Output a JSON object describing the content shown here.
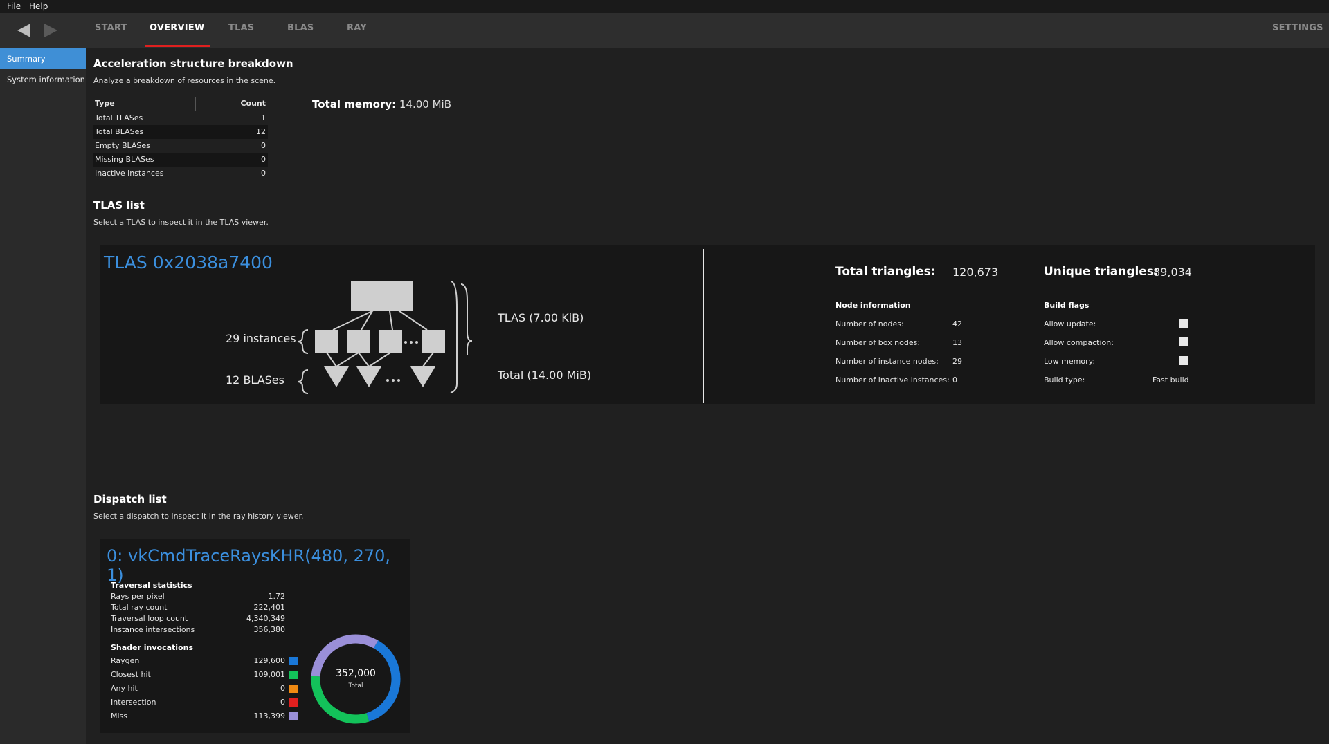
{
  "menu": {
    "file": "File",
    "help": "Help"
  },
  "nav": {
    "tabs": [
      "START",
      "OVERVIEW",
      "TLAS",
      "BLAS",
      "RAY"
    ],
    "settings": "SETTINGS"
  },
  "sidebar": {
    "items": [
      "Summary",
      "System information"
    ]
  },
  "breakdown": {
    "title": "Acceleration structure breakdown",
    "subtitle": "Analyze a breakdown of resources in the scene.",
    "col_type": "Type",
    "col_count": "Count",
    "rows": [
      {
        "type": "Total TLASes",
        "count": "1"
      },
      {
        "type": "Total BLASes",
        "count": "12"
      },
      {
        "type": "Empty BLASes",
        "count": "0"
      },
      {
        "type": "Missing BLASes",
        "count": "0"
      },
      {
        "type": "Inactive instances",
        "count": "0"
      }
    ],
    "total_memory_label": "Total memory:",
    "total_memory_value": "14.00 MiB"
  },
  "tlas_list": {
    "title": "TLAS list",
    "subtitle": "Select a TLAS to inspect it in the TLAS viewer.",
    "card": {
      "name": "TLAS 0x2038a7400",
      "instances_label": "29 instances",
      "blases_label": "12 BLASes",
      "tlas_size": "TLAS (7.00 KiB)",
      "total_size": "Total (14.00 MiB)",
      "total_triangles_label": "Total triangles:",
      "total_triangles": "120,673",
      "unique_triangles_label": "Unique triangles:",
      "unique_triangles": "89,034",
      "node_info_title": "Node information",
      "node_info": [
        {
          "label": "Number of nodes:",
          "value": "42"
        },
        {
          "label": "Number of box nodes:",
          "value": "13"
        },
        {
          "label": "Number of instance nodes:",
          "value": "29"
        },
        {
          "label": "Number of inactive instances:",
          "value": "0"
        }
      ],
      "build_flags_title": "Build flags",
      "build_flags": [
        {
          "label": "Allow update:",
          "checked": false
        },
        {
          "label": "Allow compaction:",
          "checked": false
        },
        {
          "label": "Low memory:",
          "checked": false
        }
      ],
      "build_type_label": "Build type:",
      "build_type": "Fast build"
    }
  },
  "dispatch_list": {
    "title": "Dispatch list",
    "subtitle": "Select a dispatch to inspect it in the ray history viewer.",
    "card": {
      "name": "0: vkCmdTraceRaysKHR(480, 270, 1)",
      "traversal_title": "Traversal statistics",
      "traversal": [
        {
          "label": "Rays per pixel",
          "value": "1.72"
        },
        {
          "label": "Total ray count",
          "value": "222,401"
        },
        {
          "label": "Traversal loop count",
          "value": "4,340,349"
        },
        {
          "label": "Instance intersections",
          "value": "356,380"
        }
      ],
      "shader_title": "Shader invocations",
      "shaders": [
        {
          "label": "Raygen",
          "value": "129,600",
          "color": "#1a78d8"
        },
        {
          "label": "Closest hit",
          "value": "109,001",
          "color": "#13c25a"
        },
        {
          "label": "Any hit",
          "value": "0",
          "color": "#f08a12"
        },
        {
          "label": "Intersection",
          "value": "0",
          "color": "#e0201f"
        },
        {
          "label": "Miss",
          "value": "113,399",
          "color": "#9a8fd8"
        }
      ],
      "donut_total": "352,000",
      "donut_label": "Total"
    }
  },
  "chart_data": {
    "type": "pie",
    "categories": [
      "Raygen",
      "Closest hit",
      "Any hit",
      "Intersection",
      "Miss"
    ],
    "values": [
      129600,
      109001,
      0,
      0,
      113399
    ],
    "colors": [
      "#1a78d8",
      "#13c25a",
      "#f08a12",
      "#e0201f",
      "#9a8fd8"
    ],
    "center_value": "352,000",
    "center_label": "Total"
  }
}
